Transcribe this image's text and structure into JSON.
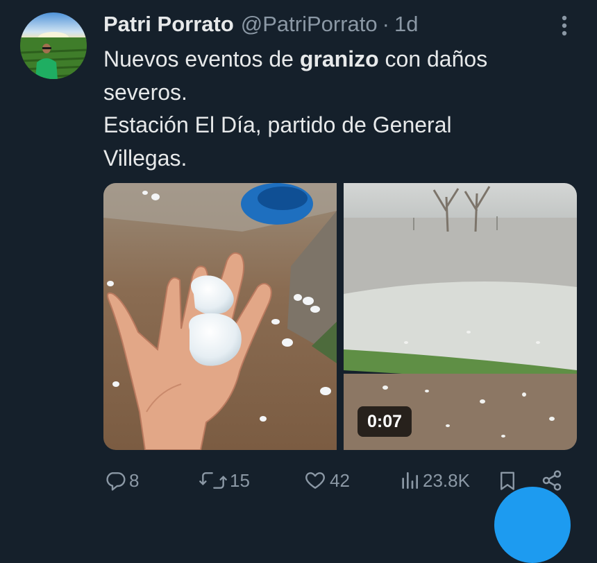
{
  "tweet": {
    "author": {
      "display_name": "Patri Porrato",
      "handle": "@PatriPorrato",
      "avatar_icon": "avatar-photo"
    },
    "separator": "·",
    "timestamp": "1d",
    "text": {
      "line1_before": "Nuevos eventos de ",
      "line1_bold": "granizo",
      "line1_after": " con daños",
      "line2": "severos.",
      "line3": "Estación El Día, partido de General",
      "line4": "Villegas."
    },
    "media": [
      {
        "type": "photo"
      },
      {
        "type": "video",
        "duration": "0:07"
      }
    ],
    "actions": {
      "replies": "8",
      "retweets": "15",
      "likes": "42",
      "views": "23.8K"
    }
  },
  "colors": {
    "background": "#15202b",
    "primary_text": "#e7e9ea",
    "secondary_text": "#8b98a5",
    "accent": "#1d9bf0"
  },
  "icons": {
    "more": "more-vertical-icon",
    "reply": "reply-icon",
    "retweet": "retweet-icon",
    "like": "heart-icon",
    "views": "views-icon",
    "bookmark": "bookmark-icon",
    "share": "share-icon"
  }
}
